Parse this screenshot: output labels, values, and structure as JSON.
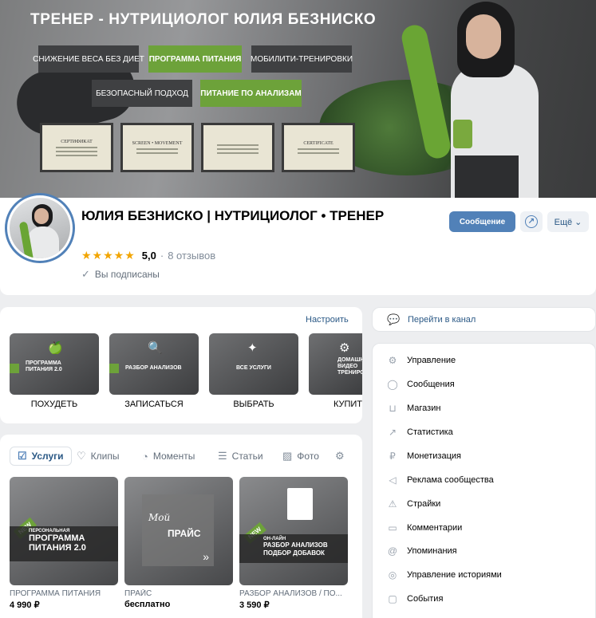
{
  "cover": {
    "title": "ТРЕНЕР - НУТРИЦИОЛОГ ЮЛИЯ БЕЗНИСКО",
    "tags": [
      {
        "label": "СНИЖЕНИЕ ВЕСА БЕЗ ДИЕТ",
        "style": "dark"
      },
      {
        "label": "ПРОГРАММА ПИТАНИЯ",
        "style": "green"
      },
      {
        "label": "МОБИЛИТИ-ТРЕНИРОВКИ",
        "style": "dark"
      },
      {
        "label": "БЕЗОПАСНЫЙ ПОДХОД",
        "style": "dark"
      },
      {
        "label": "ПИТАНИЕ ПО АНАЛИЗАМ",
        "style": "green"
      }
    ],
    "certificates": [
      "СЕРТИФИКАТ",
      "SCREEN • MOVEMENT",
      "",
      "CERTIFICATE"
    ]
  },
  "profile": {
    "name": "ЮЛИЯ БЕЗНИСКО | НУТРИЦИОЛОГ • ТРЕНЕР",
    "stars": "★★★★★",
    "rating": "5,0",
    "dot": "·",
    "reviews": "8 отзывов",
    "subscribed": "Вы подписаны",
    "message_button": "Сообщение",
    "more_button": "Ещё ⌄"
  },
  "menu": {
    "setup_link": "Настроить",
    "tiles": [
      {
        "tile_text": "ПРОГРАММА\nПИТАНИЯ 2.0",
        "label": "ПОХУДЕТЬ",
        "icon": "apple-icon"
      },
      {
        "tile_text": "РАЗБОР АНАЛИЗОВ",
        "label": "ЗАПИСАТЬСЯ",
        "icon": "magnifier-icon"
      },
      {
        "tile_text": "ВСЕ УСЛУГИ",
        "label": "ВЫБРАТЬ",
        "icon": "sparkle-icon"
      },
      {
        "tile_text": "ДОМАШНИЕ\nВИДЕО\nТРЕНИРОВ",
        "label": "КУПИТ",
        "icon": "fitness-icon"
      }
    ]
  },
  "content": {
    "tabs": [
      {
        "label": "Услуги",
        "icon": "bag-check-icon"
      },
      {
        "label": "Клипы",
        "icon": "clip-icon"
      },
      {
        "label": "Моменты",
        "icon": "moments-icon"
      },
      {
        "label": "Статьи",
        "icon": "article-icon"
      },
      {
        "label": "Фото",
        "icon": "photo-icon"
      }
    ],
    "products": [
      {
        "name": "ПРОГРАММА ПИТАНИЯ",
        "price": "4 990 ₽",
        "badge": "NEW",
        "caption_small": "ПЕРСОНАЛЬНАЯ",
        "caption": "ПРОГРАММА\nПИТАНИЯ 2.0"
      },
      {
        "name": "ПРАЙС",
        "price": "бесплатно",
        "badge": "",
        "caption_small": "Мой",
        "caption": "ПРАЙС"
      },
      {
        "name": "РАЗБОР АНАЛИЗОВ / ПО...",
        "price": "3 590 ₽",
        "badge": "NEW",
        "caption_small": "ОН-ЛАЙН",
        "caption": "РАЗБОР АНАЛИЗОВ\nПОДБОР ДОБАВОК"
      }
    ]
  },
  "sidebar": {
    "channel": "Перейти в канал",
    "items": [
      {
        "label": "Управление",
        "icon": "gear-icon"
      },
      {
        "label": "Сообщения",
        "icon": "message-icon"
      },
      {
        "label": "Магазин",
        "icon": "shop-bag-icon"
      },
      {
        "label": "Статистика",
        "icon": "stats-icon"
      },
      {
        "label": "Монетизация",
        "icon": "ruble-icon"
      },
      {
        "label": "Реклама сообщества",
        "icon": "megaphone-icon"
      },
      {
        "label": "Страйки",
        "icon": "warning-icon"
      },
      {
        "label": "Комментарии",
        "icon": "comment-icon"
      },
      {
        "label": "Упоминания",
        "icon": "at-icon"
      },
      {
        "label": "Управление историями",
        "icon": "stories-icon"
      },
      {
        "label": "События",
        "icon": "calendar-icon"
      }
    ]
  },
  "colors": {
    "accent": "#5181b8",
    "green": "#6da23a",
    "link": "#2a5885",
    "star": "#f2a500"
  }
}
